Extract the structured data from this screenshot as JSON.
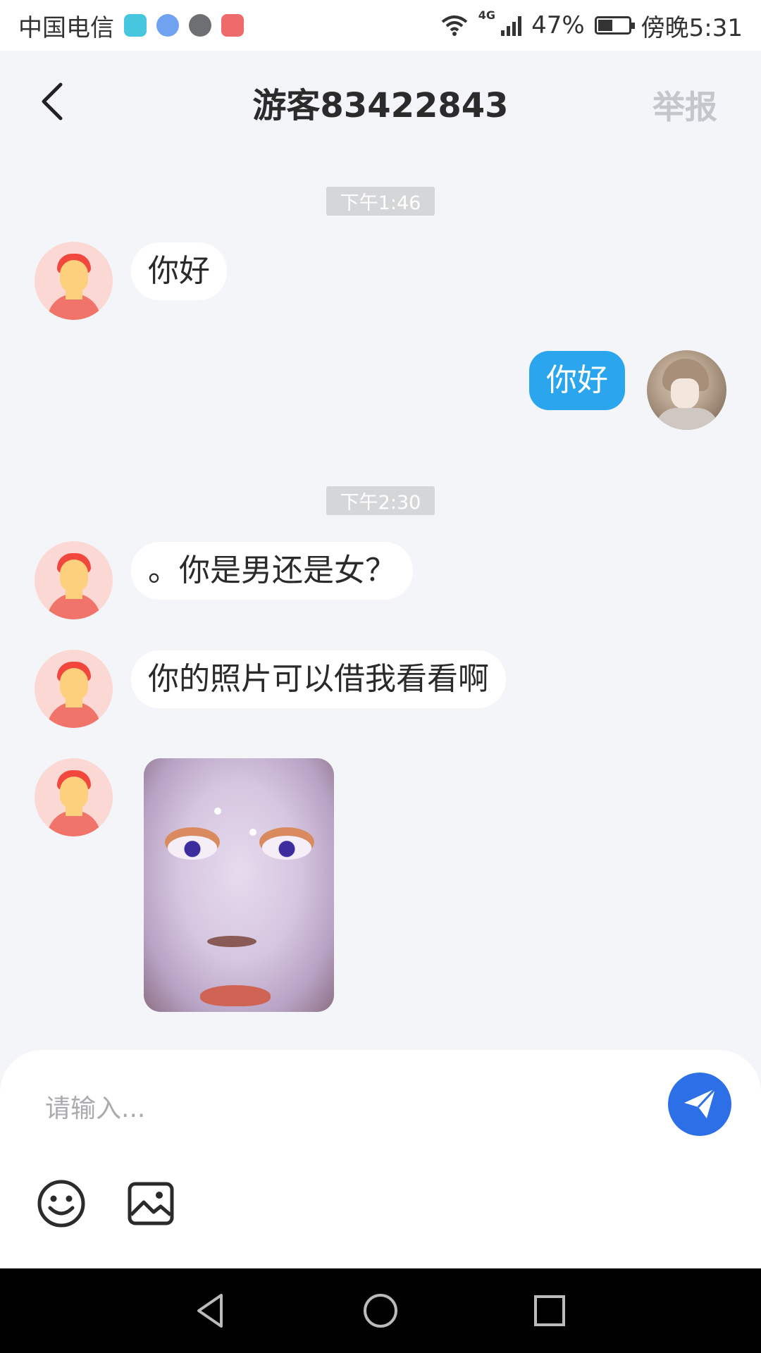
{
  "status_bar": {
    "carrier": "中国电信",
    "network": "4G",
    "battery": "47%",
    "time": "傍晚5:31",
    "app_icons": [
      "shield-icon",
      "globe-icon",
      "chat-icon",
      "huawei-store-icon"
    ]
  },
  "header": {
    "title": "游客83422843",
    "report_label": "举报"
  },
  "messages": {
    "time_1": "下午1:46",
    "msg_1": "你好",
    "msg_2": "你好",
    "time_2": "下午2:30",
    "msg_3": "。你是男还是女？",
    "msg_4": "你的照片可以借我看看啊"
  },
  "composer": {
    "placeholder": "请输入..."
  },
  "colors": {
    "background": "#f3f5f8",
    "my_bubble": "#2aa5ee",
    "send_button": "#2d6fe6",
    "report_text": "#c3c6ca"
  }
}
